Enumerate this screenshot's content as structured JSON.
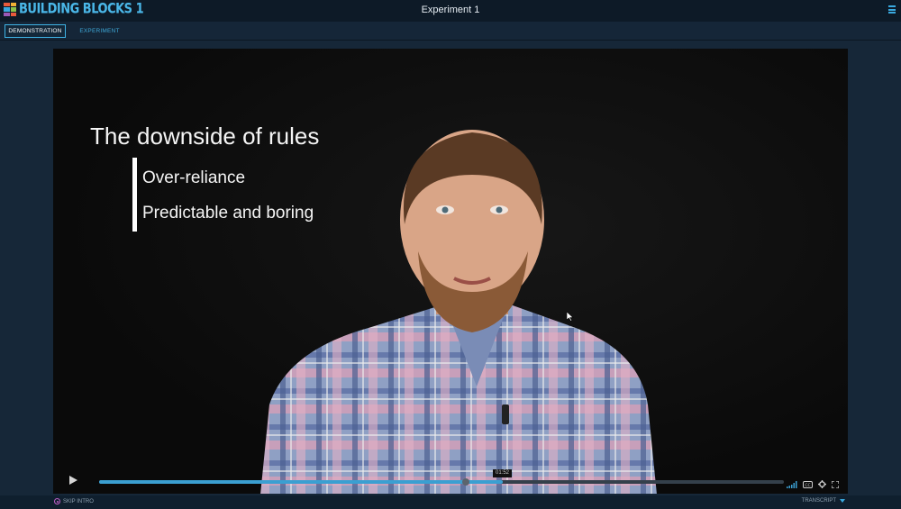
{
  "app": {
    "logo_text": "BUILDING BLOCKS 1",
    "window_title": "Experiment 1"
  },
  "tabs": [
    {
      "label": "DEMONSTRATION",
      "active": true
    },
    {
      "label": "EXPERIMENT",
      "active": false
    }
  ],
  "slide": {
    "title": "The downside of rules",
    "bullets": [
      "Over-reliance",
      "Predictable and boring"
    ]
  },
  "player": {
    "time_tooltip": "01:52",
    "progress": 0.59,
    "icons": [
      "play-icon",
      "signal-icon",
      "closed-caption-icon",
      "gear-icon",
      "fullscreen-icon"
    ]
  },
  "footer": {
    "skip_label": "SKIP INTRO",
    "transcript_label": "TRANSCRIPT"
  },
  "colors": {
    "accent": "#3fb3e5",
    "background": "#0f1f2e",
    "video_bg": "#0b0b0b"
  }
}
